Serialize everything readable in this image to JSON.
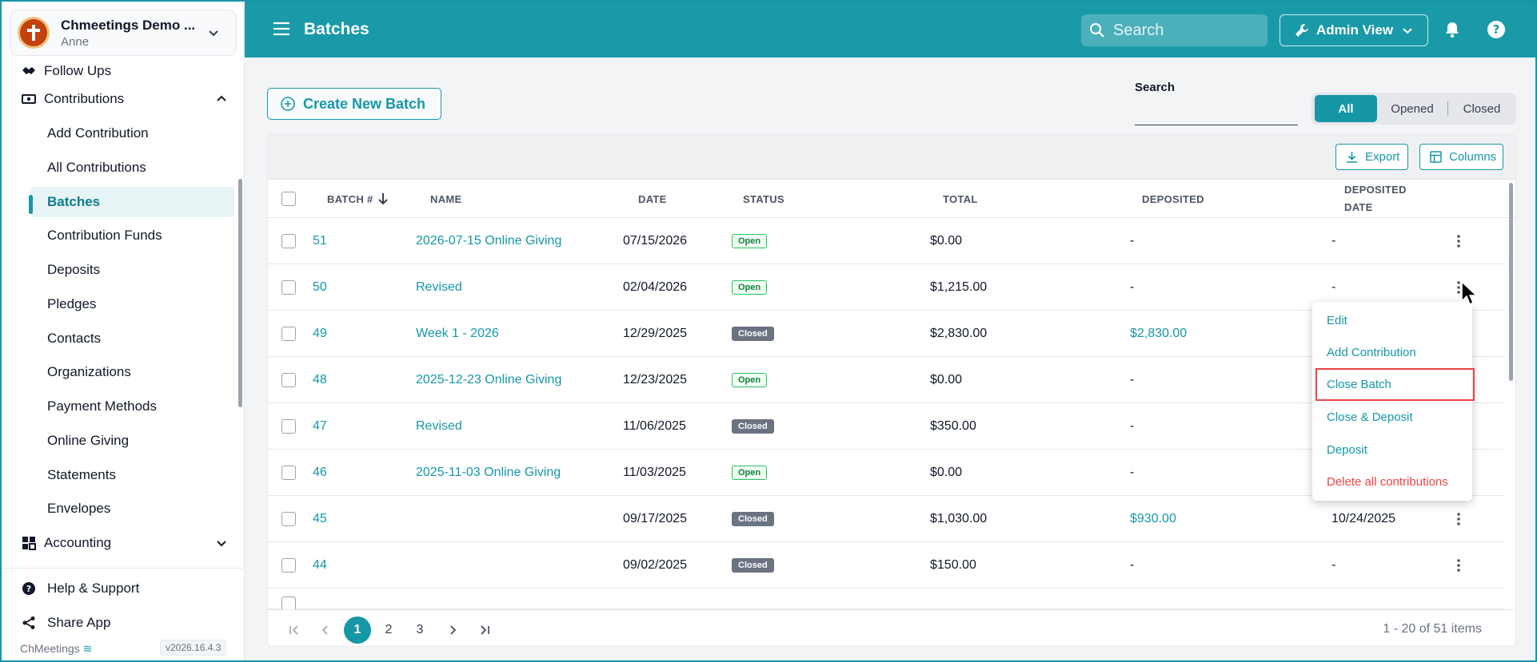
{
  "org": {
    "name": "Chmeetings Demo ...",
    "user": "Anne"
  },
  "sidebar": {
    "items": [
      {
        "label": "Follow Ups",
        "icon": "handshake-icon"
      },
      {
        "label": "Contributions",
        "icon": "money-icon"
      },
      {
        "label": "Add Contribution"
      },
      {
        "label": "All Contributions"
      },
      {
        "label": "Batches"
      },
      {
        "label": "Contribution Funds"
      },
      {
        "label": "Deposits"
      },
      {
        "label": "Pledges"
      },
      {
        "label": "Contacts"
      },
      {
        "label": "Organizations"
      },
      {
        "label": "Payment Methods"
      },
      {
        "label": "Online Giving"
      },
      {
        "label": "Statements"
      },
      {
        "label": "Envelopes"
      },
      {
        "label": "Accounting",
        "icon": "grid-icon"
      }
    ],
    "bottom": [
      {
        "label": "Help & Support",
        "icon": "question-circle-icon"
      },
      {
        "label": "Share App",
        "icon": "share-icon"
      }
    ],
    "brand": "ChMeetings",
    "version": "v2026.16.4.3"
  },
  "header": {
    "title": "Batches",
    "search_placeholder": "Search",
    "admin_label": "Admin View"
  },
  "main": {
    "create_label": "Create New Batch",
    "search_label": "Search",
    "filters": [
      "All",
      "Opened",
      "Closed"
    ],
    "export_label": "Export",
    "columns_label": "Columns"
  },
  "table": {
    "headers": [
      "BATCH #",
      "NAME",
      "DATE",
      "STATUS",
      "TOTAL",
      "DEPOSITED",
      "DEPOSITED",
      "DATE"
    ],
    "rows": [
      {
        "batch": "51",
        "name": "2026-07-15 Online Giving",
        "date": "07/15/2026",
        "status": "Open",
        "total": "$0.00",
        "deposited": "-",
        "deposited_date": "-"
      },
      {
        "batch": "50",
        "name": "Revised",
        "date": "02/04/2026",
        "status": "Open",
        "total": "$1,215.00",
        "deposited": "-",
        "deposited_date": "-"
      },
      {
        "batch": "49",
        "name": "Week 1 - 2026",
        "date": "12/29/2025",
        "status": "Closed",
        "total": "$2,830.00",
        "deposited": "$2,830.00",
        "deposited_date": ""
      },
      {
        "batch": "48",
        "name": "2025-12-23 Online Giving",
        "date": "12/23/2025",
        "status": "Open",
        "total": "$0.00",
        "deposited": "-",
        "deposited_date": ""
      },
      {
        "batch": "47",
        "name": "Revised",
        "date": "11/06/2025",
        "status": "Closed",
        "total": "$350.00",
        "deposited": "-",
        "deposited_date": ""
      },
      {
        "batch": "46",
        "name": "2025-11-03 Online Giving",
        "date": "11/03/2025",
        "status": "Open",
        "total": "$0.00",
        "deposited": "-",
        "deposited_date": ""
      },
      {
        "batch": "45",
        "name": "",
        "date": "09/17/2025",
        "status": "Closed",
        "total": "$1,030.00",
        "deposited": "$930.00",
        "deposited_date": "10/24/2025"
      },
      {
        "batch": "44",
        "name": "",
        "date": "09/02/2025",
        "status": "Closed",
        "total": "$150.00",
        "deposited": "-",
        "deposited_date": "-"
      }
    ]
  },
  "pagination": {
    "pages": [
      "1",
      "2",
      "3"
    ],
    "current": "1",
    "info": "1 - 20 of 51 items"
  },
  "menu": {
    "items": [
      "Edit",
      "Add Contribution",
      "Close Batch",
      "Close & Deposit",
      "Deposit",
      "Delete all contributions"
    ]
  },
  "colors": {
    "accent": "#1a9aa8",
    "danger": "#ef4444",
    "open": "#22c55e",
    "closed": "#6b7280"
  }
}
